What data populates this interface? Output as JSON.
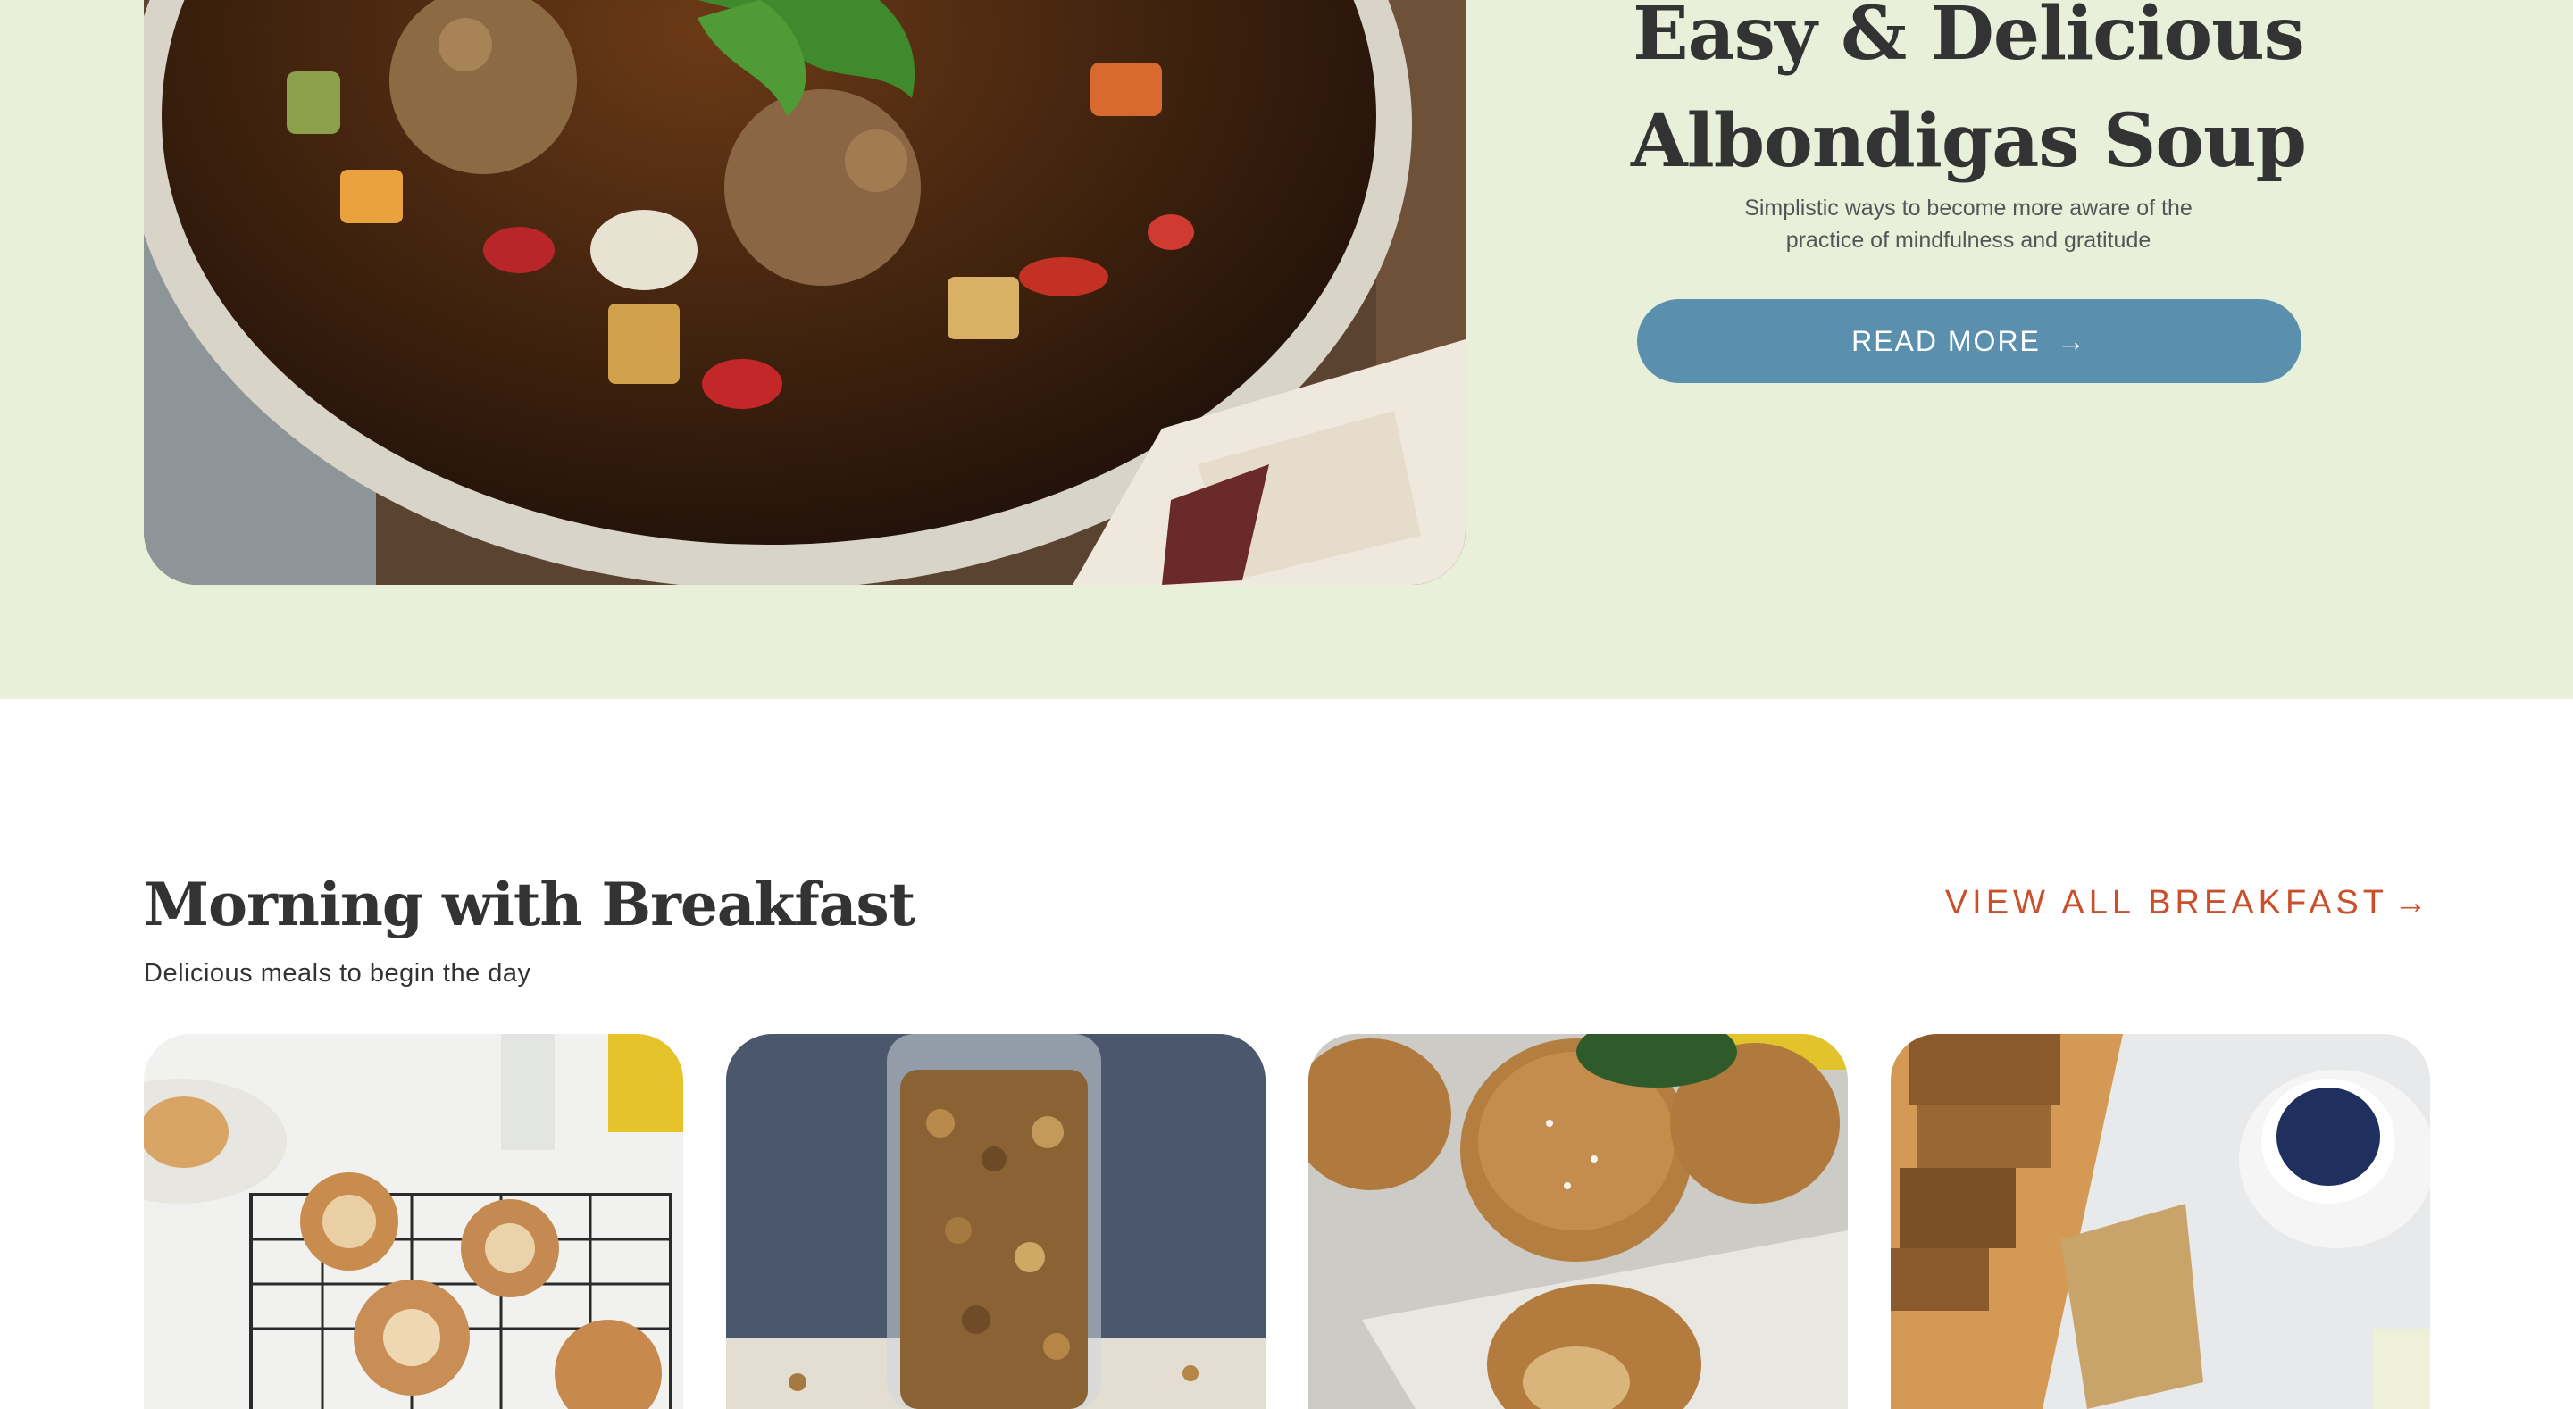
{
  "hero": {
    "title_line1": "Easy & Delicious",
    "title_line2": "Albondigas Soup",
    "subtitle_line1": "Simplistic ways to become more aware of the",
    "subtitle_line2": "practice of mindfulness and gratitude",
    "button_label": "READ MORE",
    "button_icon": "arrow-right-icon",
    "image": "albondigas-soup-photo"
  },
  "breakfast": {
    "title": "Morning with Breakfast",
    "subtitle": "Delicious meals to begin the day",
    "view_all_label": "VIEW ALL BREAKFAST",
    "view_all_icon": "arrow-right-icon",
    "cards": [
      {
        "image": "cinnamon-rolls-photo"
      },
      {
        "image": "granola-jar-photo"
      },
      {
        "image": "muffins-photo"
      },
      {
        "image": "banana-bread-coffee-photo"
      }
    ]
  },
  "colors": {
    "hero_background": "#e9f0da",
    "button": "#5a8fad",
    "accent_link": "#c9502b",
    "heading": "#333333"
  }
}
